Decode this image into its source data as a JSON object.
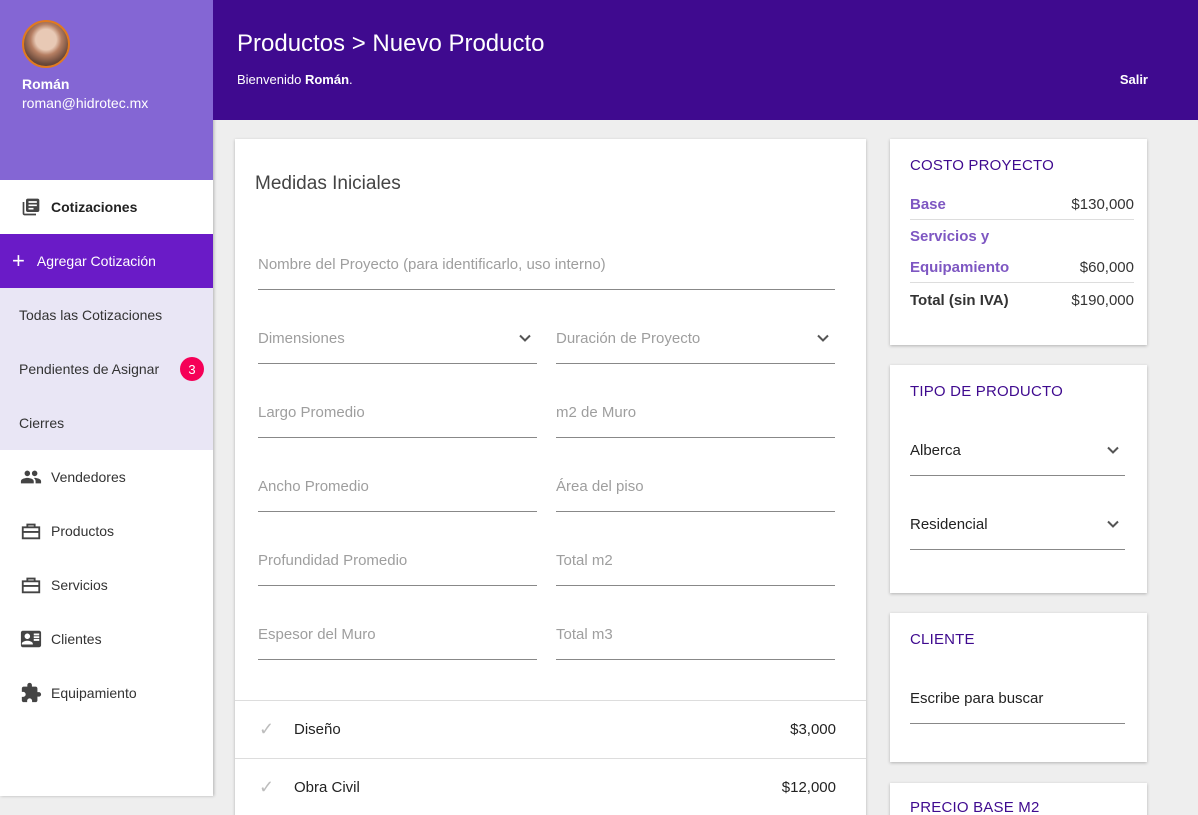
{
  "user": {
    "name": "Román",
    "email": "roman@hidrotec.mx"
  },
  "sidebar": {
    "section_title": "Cotizaciones",
    "add_label": "Agregar Cotización",
    "sub_items": [
      {
        "label": "Todas las Cotizaciones"
      },
      {
        "label": "Pendientes de Asignar",
        "badge": "3"
      },
      {
        "label": "Cierres"
      }
    ],
    "items": [
      {
        "label": "Vendedores",
        "icon": "people-icon"
      },
      {
        "label": "Productos",
        "icon": "briefcase-icon"
      },
      {
        "label": "Servicios",
        "icon": "briefcase-icon"
      },
      {
        "label": "Clientes",
        "icon": "contact-card-icon"
      },
      {
        "label": "Equipamiento",
        "icon": "puzzle-icon"
      }
    ]
  },
  "header": {
    "title": "Productos > Nuevo Producto",
    "welcome_prefix": "Bienvenido ",
    "welcome_name": "Román",
    "welcome_suffix": ".",
    "logout": "Salir"
  },
  "form": {
    "title": "Medidas Iniciales",
    "project_name_placeholder": "Nombre del Proyecto (para identificarlo, uso interno)",
    "dimensions": "Dimensiones",
    "duration": "Duración de Proyecto",
    "largo": "Largo Promedio",
    "m2_muro": "m2 de Muro",
    "ancho": "Ancho Promedio",
    "area_piso": "Área del piso",
    "profundidad": "Profundidad Promedio",
    "total_m2": "Total m2",
    "espesor": "Espesor del Muro",
    "total_m3": "Total m3",
    "services": [
      {
        "label": "Diseño",
        "price": "$3,000"
      },
      {
        "label": "Obra Civil",
        "price": "$12,000"
      }
    ]
  },
  "cost": {
    "title": "COSTO PROYECTO",
    "base_label": "Base",
    "base_value": "$130,000",
    "services_label_1": "Servicios y",
    "services_label_2": "Equipamiento",
    "services_value": "$60,000",
    "total_label": "Total (sin IVA)",
    "total_value": "$190,000"
  },
  "product_type": {
    "title": "TIPO DE PRODUCTO",
    "type_value": "Alberca",
    "category_value": "Residencial"
  },
  "client": {
    "title": "CLIENTE",
    "search_placeholder": "Escribe para buscar"
  },
  "price_base": {
    "title": "PRECIO BASE M2"
  },
  "colors": {
    "header": "#3f0a8f",
    "profile": "#8466d4",
    "primary_nav": "#6a1bc7",
    "subnav_bg": "#e9e6f5",
    "badge": "#f50057",
    "label_accent": "#7e57c2"
  }
}
